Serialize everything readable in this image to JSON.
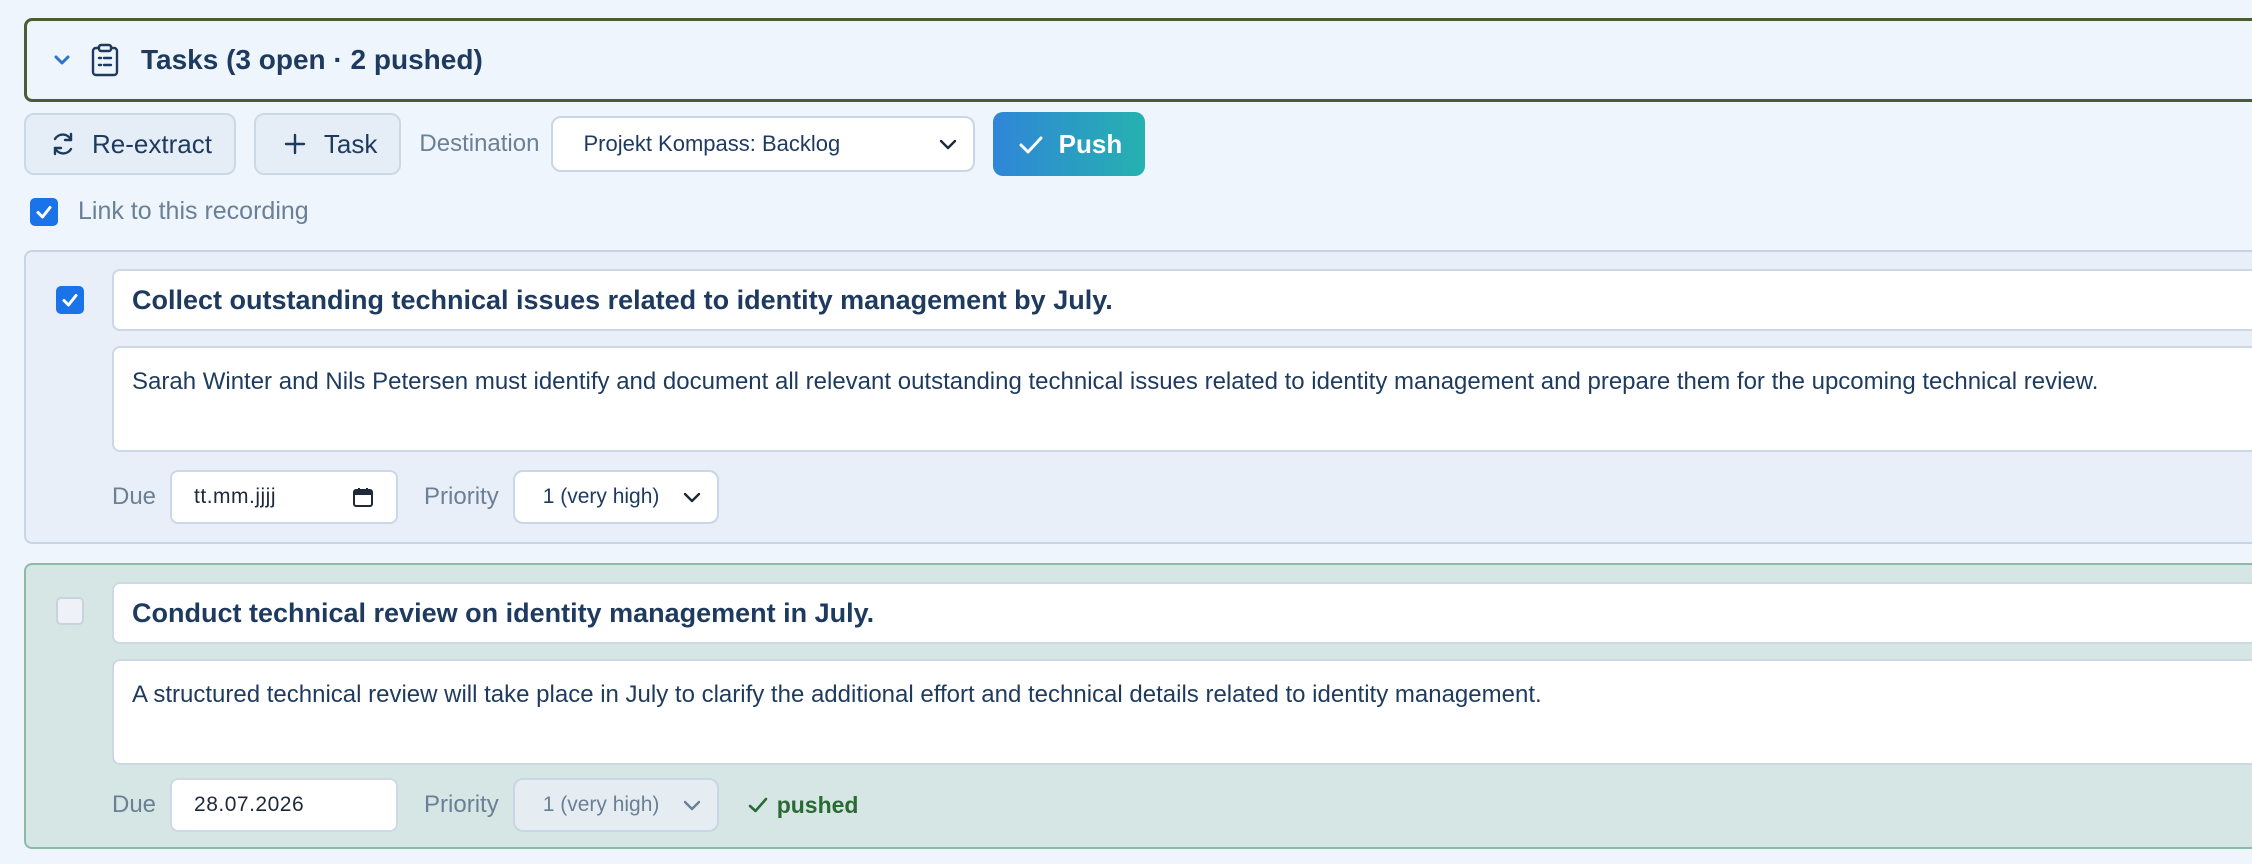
{
  "header": {
    "title": "Tasks (3 open · 2 pushed)",
    "expand_icon": "chevron-down-icon",
    "section_icon": "clipboard-list-icon"
  },
  "toolbar": {
    "reextract_label": "Re-extract",
    "reextract_icon": "refresh-icon",
    "add_task_label": "Task",
    "add_task_icon": "plus-icon",
    "destination_label": "Destination",
    "destination_value": "Projekt Kompass: Backlog",
    "push_label": "Push",
    "push_icon": "check-icon"
  },
  "link_recording": {
    "label": "Link to this recording",
    "checked": true
  },
  "tasks": [
    {
      "selected": true,
      "title": "Collect outstanding technical issues related to identity management by July.",
      "description": "Sarah Winter and Nils Petersen must identify and document all relevant outstanding technical issues related to identity management and prepare them for the upcoming technical review.",
      "due_label": "Due",
      "due_value": "tt.mm.jjjj",
      "priority_label": "Priority",
      "priority_value": "1 (very high)",
      "status": ""
    },
    {
      "selected": false,
      "title": "Conduct technical review on identity management in July.",
      "description": "A structured technical review will take place in July to clarify the additional effort and technical details related to identity management.",
      "due_label": "Due",
      "due_value": "28.07.2026",
      "priority_label": "Priority",
      "priority_value": "1 (very high)",
      "status": "pushed"
    }
  ],
  "colors": {
    "accent": "#1a73e8",
    "push_gradient_start": "#2f86d8",
    "push_gradient_end": "#26b1b0",
    "pushed_text": "#2a6b34",
    "header_border": "#4b5d35",
    "pushed_card_bg": "#d6e6e4"
  }
}
